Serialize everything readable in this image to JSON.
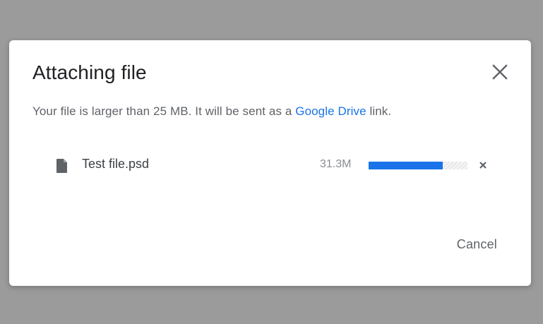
{
  "dialog": {
    "title": "Attaching file",
    "message_prefix": "Your file is larger than 25 MB. It will be sent as a ",
    "message_link": "Google Drive",
    "message_suffix": " link.",
    "cancel_label": "Cancel",
    "close_icon": "close-icon"
  },
  "file": {
    "icon": "file-icon",
    "name": "Test file.psd",
    "size": "31.3M",
    "progress": 0.75,
    "remove_icon": "remove-icon"
  },
  "colors": {
    "backdrop": "#9b9b9c",
    "accent": "#1a73e8",
    "title": "#202124",
    "secondary_text": "#5f6368"
  }
}
